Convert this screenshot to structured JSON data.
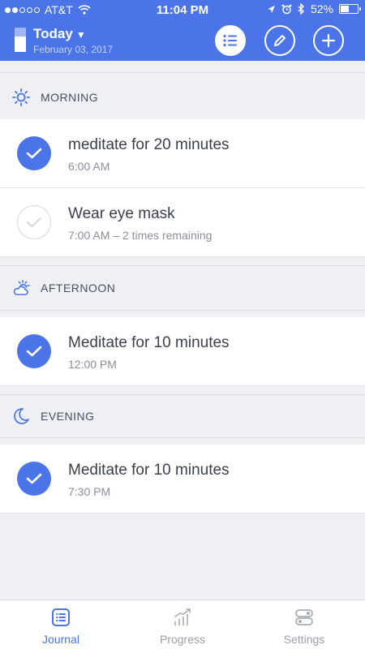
{
  "status_bar": {
    "carrier": "AT&T",
    "time": "11:04 PM",
    "battery": "52%"
  },
  "header": {
    "title": "Today",
    "date": "February 03, 2017",
    "buttons": [
      "list-icon",
      "pencil-icon",
      "plus-icon"
    ]
  },
  "sections": [
    {
      "label": "MORNING",
      "icon": "sun-icon",
      "items": [
        {
          "name": "meditate for 20 minutes",
          "time": "6:00 AM",
          "done": true
        },
        {
          "name": "Wear eye mask",
          "time": "7:00 AM – 2 times remaining",
          "done": false
        }
      ]
    },
    {
      "label": "AFTERNOON",
      "icon": "partly-cloudy-icon",
      "items": [
        {
          "name": "Meditate for 10 minutes",
          "time": "12:00 PM",
          "done": true
        }
      ]
    },
    {
      "label": "EVENING",
      "icon": "moon-icon",
      "items": [
        {
          "name": "Meditate for 10 minutes",
          "time": "7:30 PM",
          "done": true
        }
      ]
    }
  ],
  "tabs": [
    {
      "label": "Journal",
      "active": true
    },
    {
      "label": "Progress",
      "active": false
    },
    {
      "label": "Settings",
      "active": false
    }
  ],
  "colors": {
    "accent": "#4a74e8",
    "background": "#eef0f4"
  }
}
